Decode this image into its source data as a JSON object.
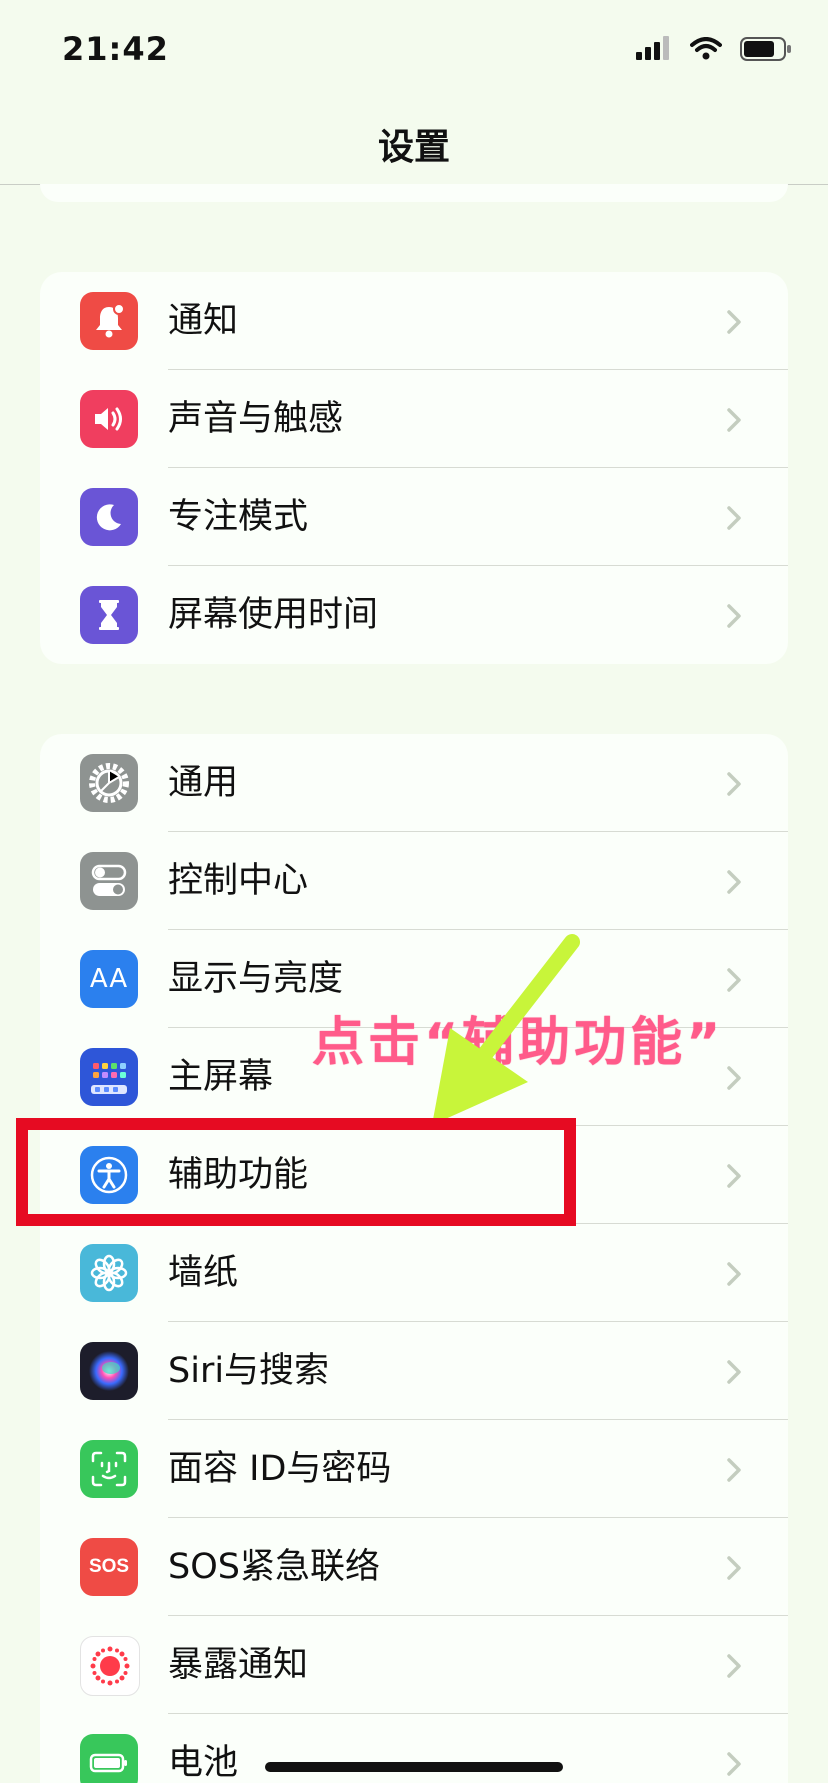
{
  "status": {
    "time": "21:42"
  },
  "nav": {
    "title": "设置"
  },
  "groups": [
    {
      "items": [
        {
          "label": "通知",
          "icon": "bell-icon",
          "color": "#ef4b45"
        },
        {
          "label": "声音与触感",
          "icon": "speaker-icon",
          "color": "#f03e5f"
        },
        {
          "label": "专注模式",
          "icon": "moon-icon",
          "color": "#6a55d6"
        },
        {
          "label": "屏幕使用时间",
          "icon": "hourglass-icon",
          "color": "#6a55d6"
        }
      ]
    },
    {
      "items": [
        {
          "label": "通用",
          "icon": "gear-icon",
          "color": "#8e9391"
        },
        {
          "label": "控制中心",
          "icon": "toggles-icon",
          "color": "#8e9391"
        },
        {
          "label": "显示与亮度",
          "icon": "text-size-icon",
          "color": "#2b80ee"
        },
        {
          "label": "主屏幕",
          "icon": "home-screen-icon",
          "color": "#2e56d8"
        },
        {
          "label": "辅助功能",
          "icon": "accessibility-icon",
          "color": "#2b80ee"
        },
        {
          "label": "墙纸",
          "icon": "flower-icon",
          "color": "#49b8d9"
        },
        {
          "label": "Siri与搜索",
          "icon": "siri-icon",
          "color": "#1d1d2b"
        },
        {
          "label": "面容 ID与密码",
          "icon": "face-id-icon",
          "color": "#38c75b"
        },
        {
          "label": "SOS紧急联络",
          "icon": "sos-icon",
          "color": "#ef4b45"
        },
        {
          "label": "暴露通知",
          "icon": "exposure-icon",
          "color": "#ffffff"
        },
        {
          "label": "电池",
          "icon": "battery-icon",
          "color": "#38c75b"
        }
      ]
    }
  ],
  "icon_texts": {
    "display": "AA",
    "sos": "SOS"
  },
  "annotation": {
    "text": "点击“辅助功能”",
    "highlight_color": "#e60b22",
    "arrow_color": "#c8f53a",
    "text_color": "#ff5b8a"
  }
}
